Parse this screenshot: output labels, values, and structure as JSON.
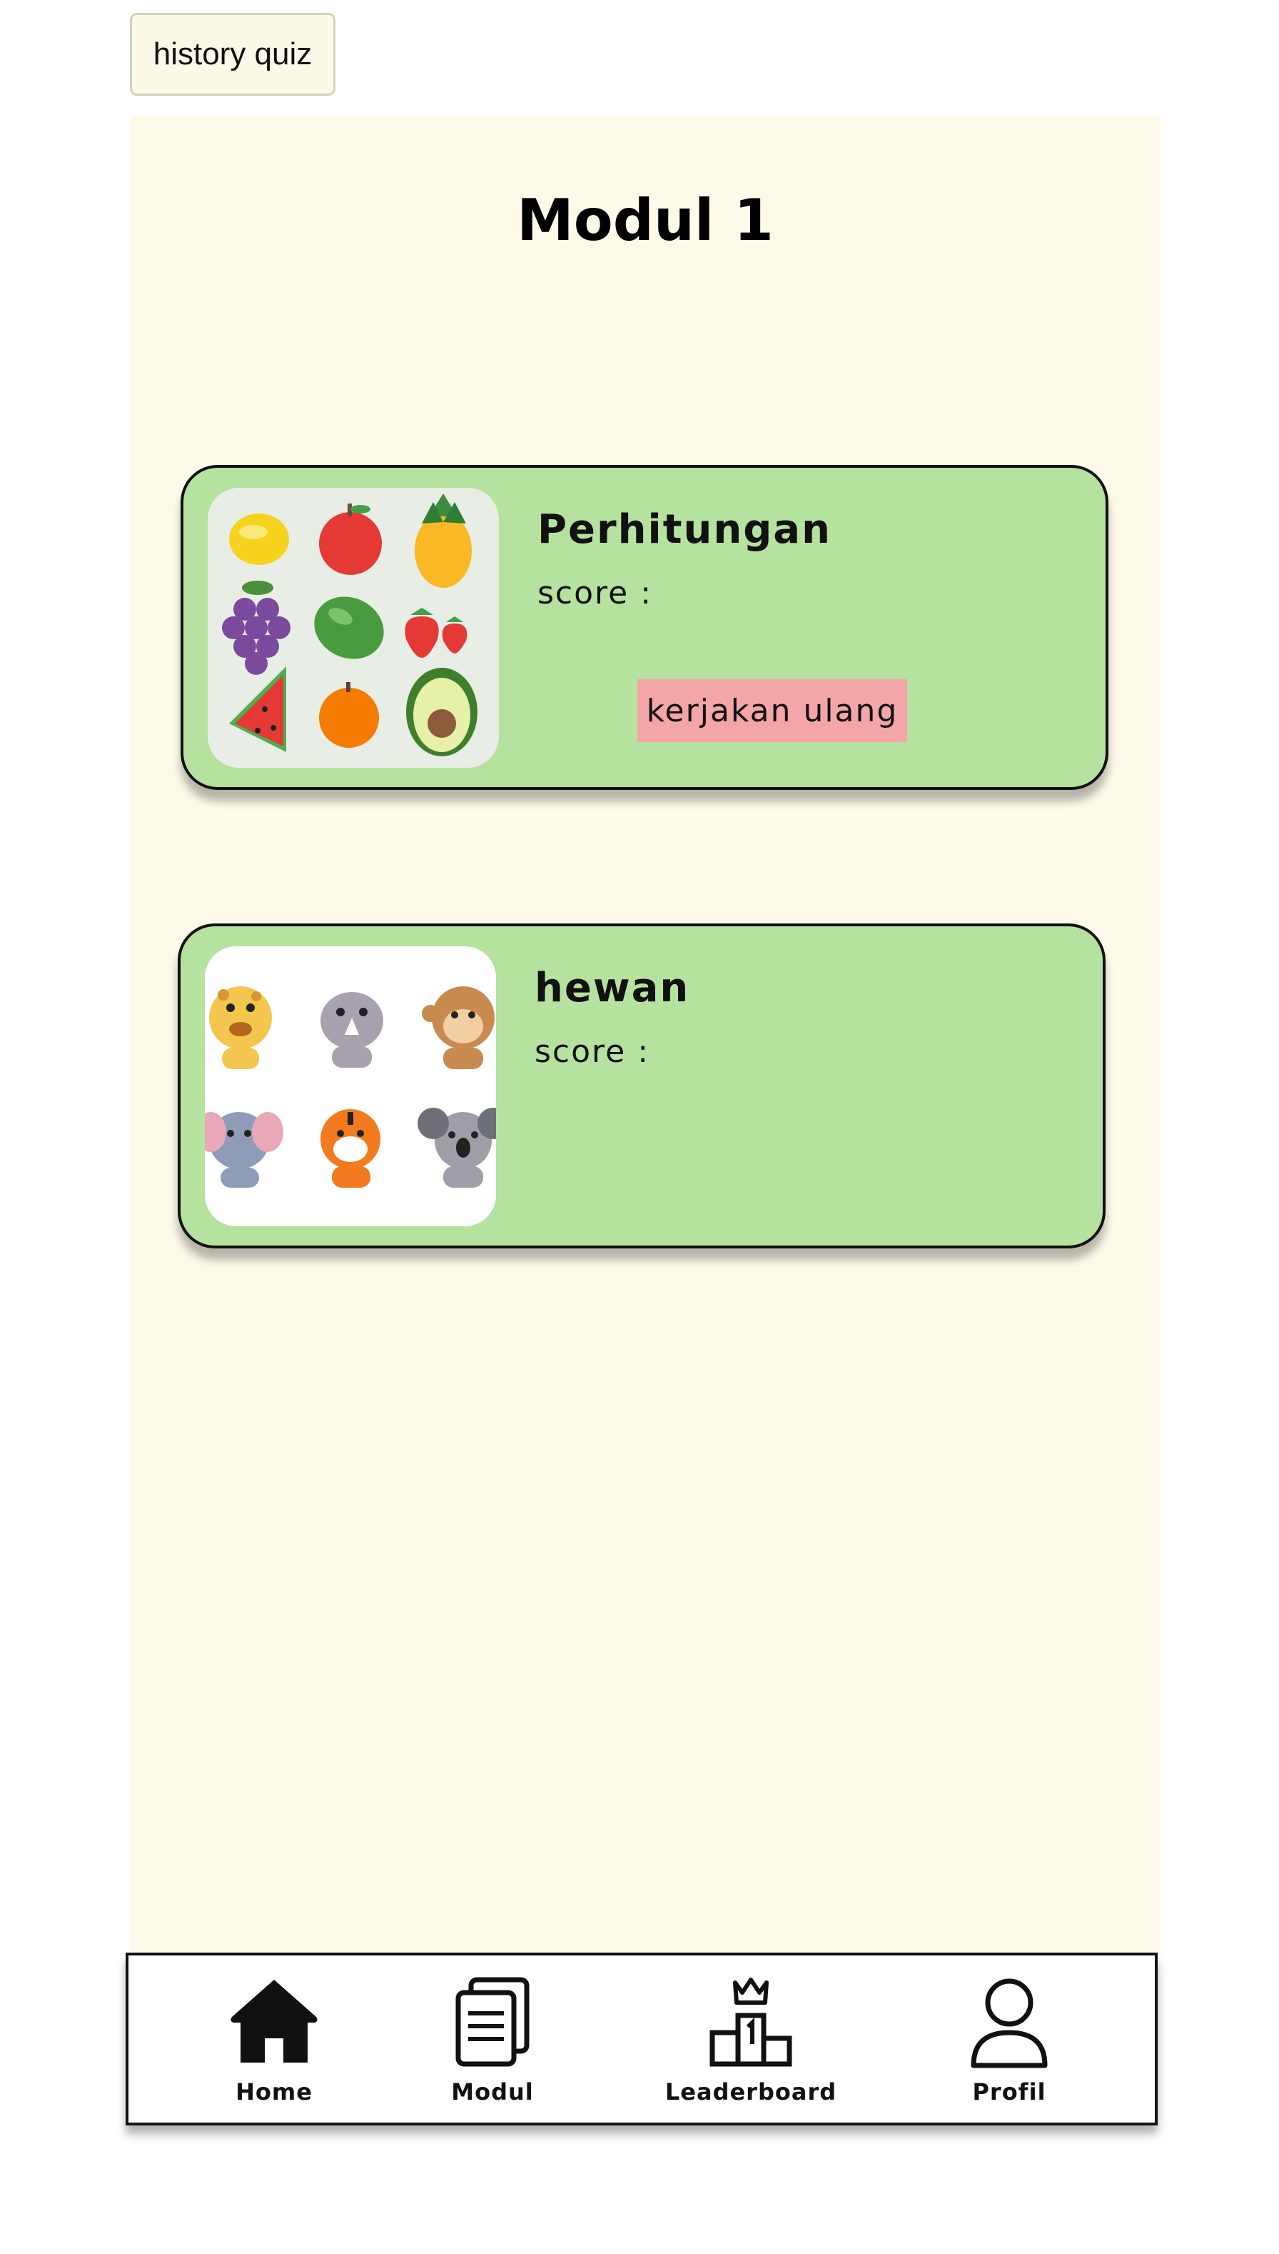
{
  "header": {
    "history_label": "history quiz"
  },
  "page": {
    "title": "Modul 1"
  },
  "quizzes": [
    {
      "title": "Perhitungan",
      "score_label": "score :",
      "retry_label": "kerjakan  ulang",
      "thumbnail": "fruits-grid"
    },
    {
      "title": "hewan",
      "score_label": "score :",
      "thumbnail": "animals-grid"
    }
  ],
  "nav": [
    {
      "label": "Home",
      "icon": "home-icon"
    },
    {
      "label": "Modul",
      "icon": "document-icon"
    },
    {
      "label": "Leaderboard",
      "icon": "podium-crown-icon"
    },
    {
      "label": "Profil",
      "icon": "user-icon"
    }
  ],
  "colors": {
    "panel_bg": "#fdfaea",
    "card_bg": "#b5e29e",
    "retry_bg": "#f4a5a7"
  }
}
